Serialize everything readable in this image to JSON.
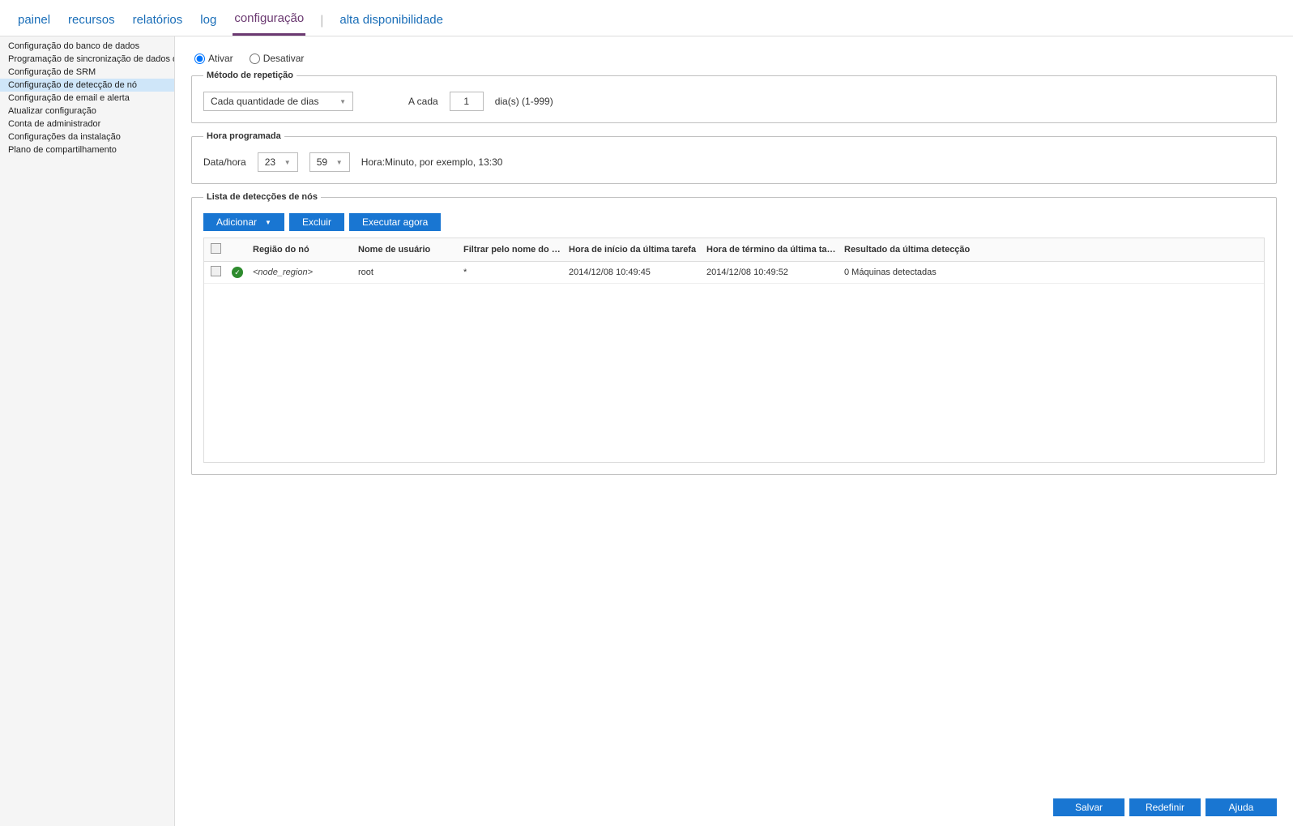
{
  "tabs": {
    "painel": "painel",
    "recursos": "recursos",
    "relatorios": "relatórios",
    "log": "log",
    "configuracao": "configuração",
    "alta": "alta disponibilidade"
  },
  "sidebar": {
    "items": [
      "Configuração do banco de dados",
      "Programação de sincronização de dados do Arc",
      "Configuração de SRM",
      "Configuração de detecção de nó",
      "Configuração de email e alerta",
      "Atualizar configuração",
      "Conta de administrador",
      "Configurações da instalação",
      "Plano de compartilhamento"
    ],
    "activeIndex": 3
  },
  "enable": {
    "on": "Ativar",
    "off": "Desativar"
  },
  "repeat": {
    "legend": "Método de repetição",
    "mode": "Cada quantidade de dias",
    "every_label": "A cada",
    "value": "1",
    "unit": "dia(s) (1-999)"
  },
  "schedule": {
    "legend": "Hora programada",
    "label": "Data/hora",
    "hour": "23",
    "minute": "59",
    "hint": "Hora:Minuto, por exemplo, 13:30"
  },
  "list": {
    "legend": "Lista de detecções de nós",
    "buttons": {
      "add": "Adicionar",
      "del": "Excluir",
      "run": "Executar agora"
    },
    "headers": {
      "region": "Região do nó",
      "user": "Nome de usuário",
      "filter": "Filtrar pelo nome do co…",
      "start": "Hora de início da última tarefa",
      "end": "Hora de término da última tarefa",
      "result": "Resultado da última detecção"
    },
    "rows": [
      {
        "region": "<node_region>",
        "user": "root",
        "filter": "*",
        "start": "2014/12/08 10:49:45",
        "end": "2014/12/08 10:49:52",
        "result": "0 Máquinas detectadas"
      }
    ]
  },
  "footer": {
    "save": "Salvar",
    "reset": "Redefinir",
    "help": "Ajuda"
  }
}
